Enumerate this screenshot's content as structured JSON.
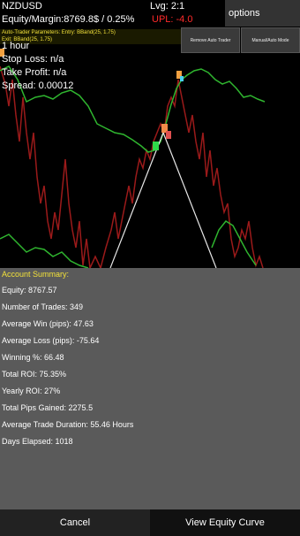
{
  "header": {
    "symbol": "NZDUSD",
    "leverage": "Lvg: 2:1",
    "equity_margin": "Equity/Margin:8769.8$ / 0.25%",
    "upl": "UPL: -4.0",
    "autotrader_params": "Auto-Trader Parameters: Entry: BBand(25, 1.75)",
    "exit_params": "Exit: BBand(25, 1.75)",
    "timeframe": "1 hour",
    "stop_loss": "Stop Loss: n/a",
    "take_profit": "Take Profit: n/a",
    "spread": "Spread: 0.00012"
  },
  "side_panel": {
    "options_label": "options",
    "remove_auto_trader": "Remove Auto Trader",
    "manual_auto_mode": "Manual/Auto Mode"
  },
  "summary": {
    "title": "Account Summary:",
    "equity": "Equity: 8767.57",
    "trades": "Number of Trades: 349",
    "avg_win": "Average Win (pips): 47.63",
    "avg_loss": "Average Loss (pips): -75.64",
    "winning": "Winning %: 66.48",
    "total_roi": "Total ROI: 75.35%",
    "yearly_roi": "Yearly ROI: 27%",
    "total_pips": "Total Pips Gained: 2275.5",
    "avg_duration": "Average Trade Duration: 55.46 Hours",
    "days_elapsed": "Days Elapsed: 1018"
  },
  "buttons": {
    "cancel": "Cancel",
    "view_equity": "View Equity Curve"
  },
  "colors": {
    "accent_yellow": "#f2e13a",
    "upl_red": "#ff2a2a",
    "price_line": "#9b1a1a",
    "band_line": "#2fb52f"
  }
}
